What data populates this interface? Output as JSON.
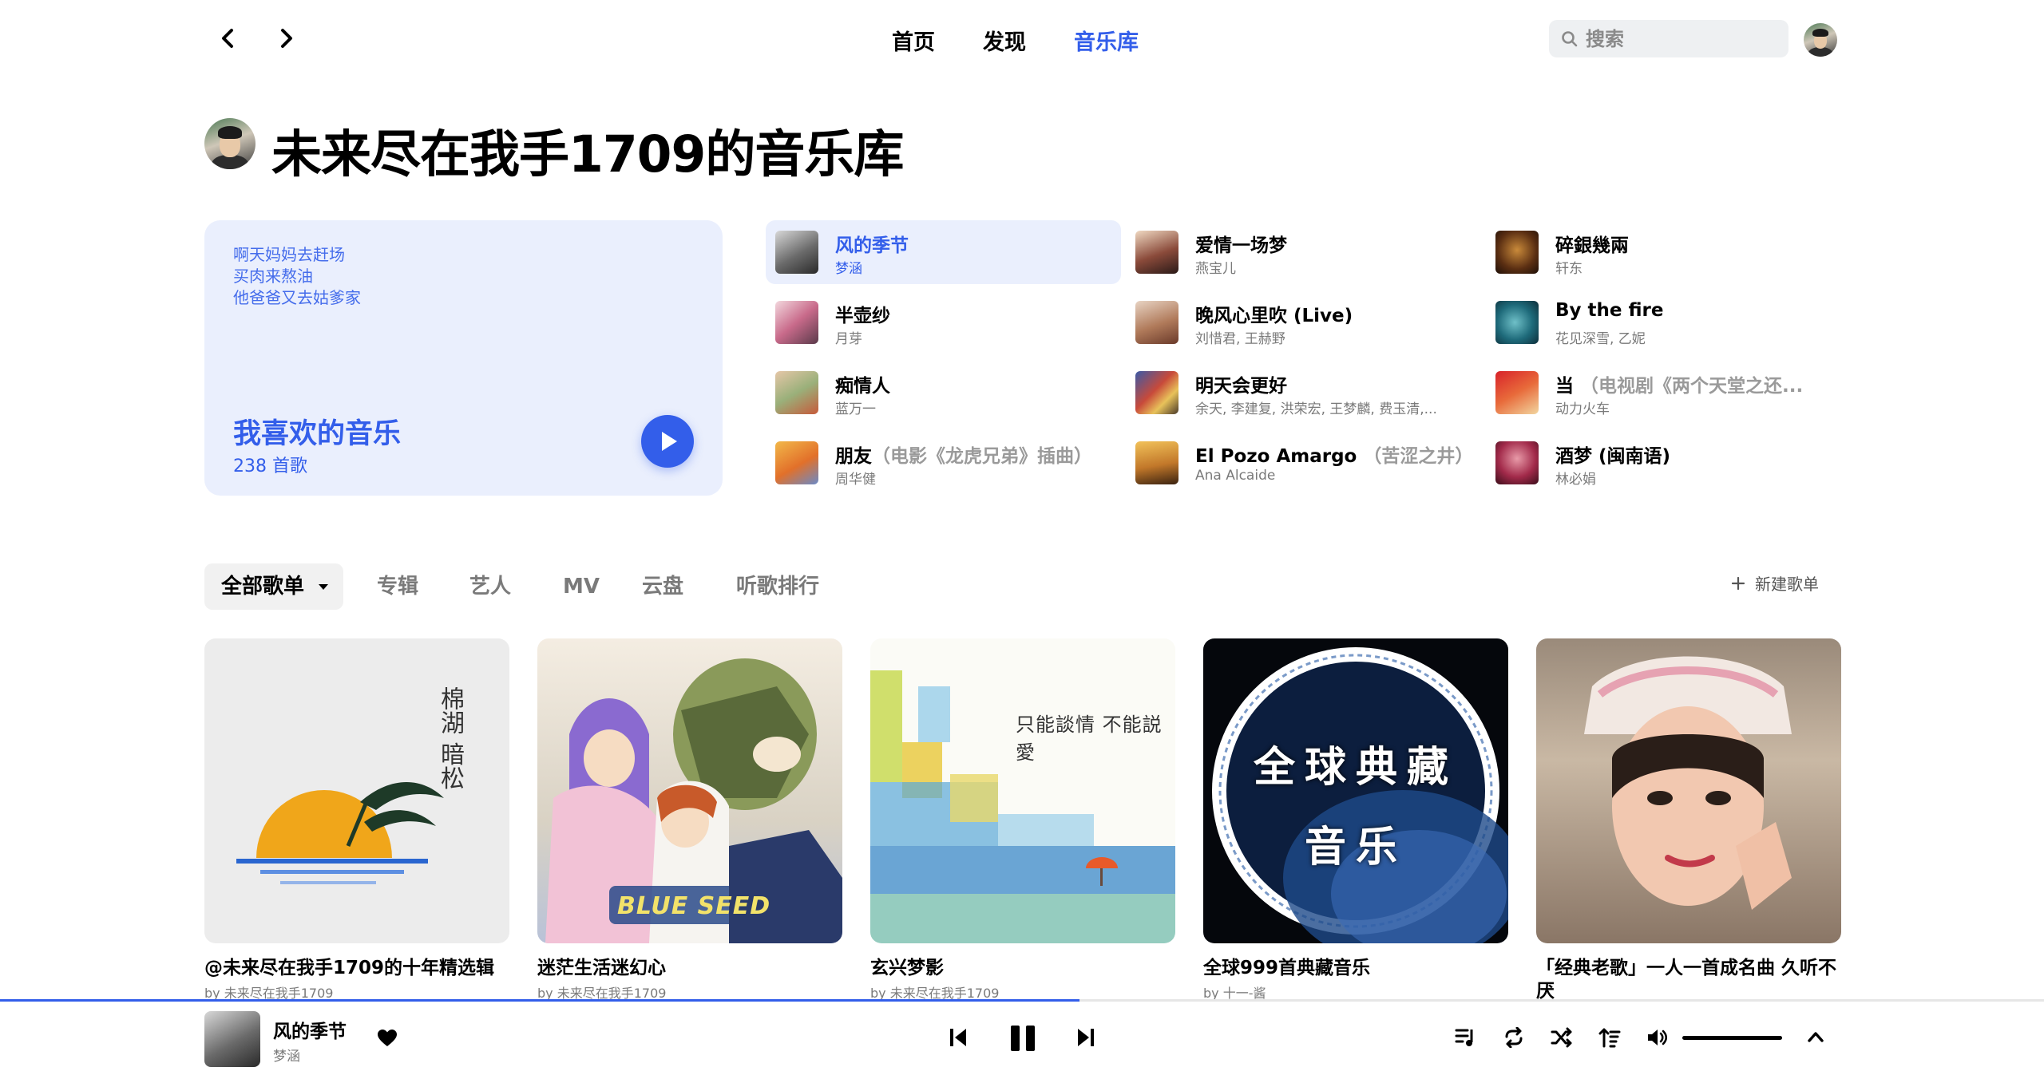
{
  "nav": {
    "back_icon": "chevron-left-icon",
    "forward_icon": "chevron-right-icon",
    "links": [
      {
        "label": "首页",
        "active": false
      },
      {
        "label": "发现",
        "active": false
      },
      {
        "label": "音乐库",
        "active": true
      }
    ],
    "search_placeholder": "搜索"
  },
  "page": {
    "title": "未来尽在我手1709的音乐库"
  },
  "liked": {
    "lyrics": [
      "啊天妈妈去赶场",
      "买肉来熬油",
      "他爸爸又去姑爹家"
    ],
    "title": "我喜欢的音乐",
    "count": "238 首歌"
  },
  "songs": [
    {
      "title": "风的季节",
      "subtitle": "",
      "artist": "梦涵",
      "active": true
    },
    {
      "title": "爱情一场梦",
      "subtitle": "",
      "artist": "燕宝儿",
      "active": false
    },
    {
      "title": "碎銀幾兩",
      "subtitle": "",
      "artist": "轩东",
      "active": false
    },
    {
      "title": "半壶纱",
      "subtitle": "",
      "artist": "月芽",
      "active": false
    },
    {
      "title": "晚风心里吹 (Live)",
      "subtitle": "",
      "artist": "刘惜君, 王赫野",
      "active": false
    },
    {
      "title": "By the fire",
      "subtitle": "",
      "artist": "花见深雪, 乙妮",
      "active": false
    },
    {
      "title": "痴情人",
      "subtitle": "",
      "artist": "蓝万一",
      "active": false
    },
    {
      "title": "明天会更好",
      "subtitle": "",
      "artist": "余天, 李建复, 洪荣宏, 王梦麟, 费玉清,...",
      "active": false
    },
    {
      "title": "当",
      "subtitle": "（电视剧《两个天堂之还...",
      "artist": "动力火车",
      "active": false
    },
    {
      "title": "朋友",
      "subtitle": "（电影《龙虎兄弟》插曲）",
      "artist": "周华健",
      "active": false
    },
    {
      "title": "El Pozo Amargo",
      "subtitle": "（苦涩之井）",
      "artist": "Ana Alcaide",
      "active": false
    },
    {
      "title": "酒梦 (闽南语)",
      "subtitle": "",
      "artist": "林必娟",
      "active": false
    }
  ],
  "tabs": {
    "all_playlists": "全部歌单",
    "albums": "专辑",
    "artists": "艺人",
    "mv": "MV",
    "cloud": "云盘",
    "ranking": "听歌排行",
    "new_playlist": "新建歌单"
  },
  "playlists": [
    {
      "name": "@未来尽在我手1709的十年精选辑",
      "by": "by 未来尽在我手1709",
      "cover_text": "棉湖 暗松"
    },
    {
      "name": "迷茫生活迷幻心",
      "by": "by 未来尽在我手1709",
      "cover_text": "BLUE SEED"
    },
    {
      "name": "玄兴梦影",
      "by": "by 未来尽在我手1709",
      "cover_text": "只能談情 不能説愛"
    },
    {
      "name": "全球999首典藏音乐",
      "by": "by 十一-酱",
      "cover_text": "全球典藏 音乐"
    },
    {
      "name": "「经典老歌」一人一首成名曲 久听不厌",
      "by": "",
      "cover_text": ""
    }
  ],
  "player": {
    "title": "风的季节",
    "artist": "梦涵",
    "progress": 0.528,
    "volume": 1.0,
    "icons": [
      "heart-icon",
      "previous-icon",
      "pause-icon",
      "next-icon",
      "playlist-icon",
      "repeat-icon",
      "shuffle-icon",
      "lyrics-icon",
      "volume-icon",
      "chevron-up-icon"
    ]
  },
  "colors": {
    "accent": "#335eea",
    "accent_light": "#eaeffd"
  }
}
